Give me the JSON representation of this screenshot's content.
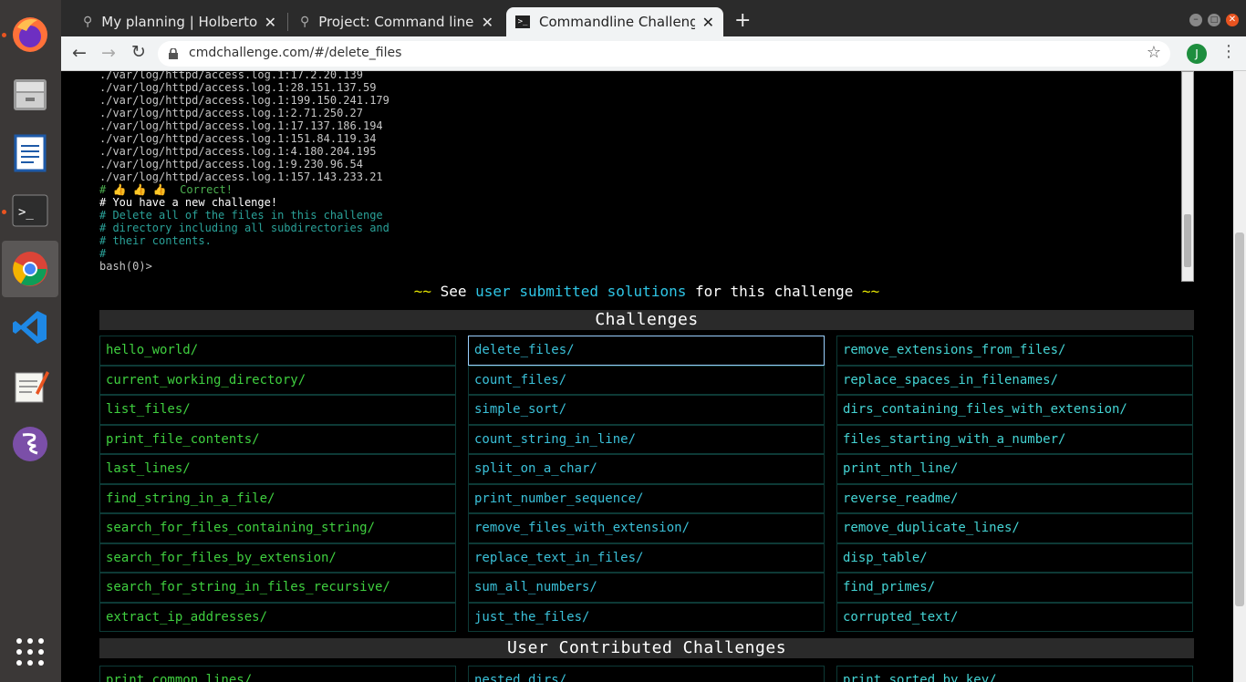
{
  "browser": {
    "tabs": [
      {
        "title": "My planning | Holberton I",
        "active": false
      },
      {
        "title": "Project: Command line fo",
        "active": false
      },
      {
        "title": "Commandline Challenge",
        "active": true
      }
    ],
    "url": "cmdchallenge.com/#/delete_files",
    "profile_initial": "J"
  },
  "terminal": {
    "output_lines": [
      "./var/log/httpd/access.log.1:17.2.20.139",
      "./var/log/httpd/access.log.1:28.151.137.59",
      "./var/log/httpd/access.log.1:199.150.241.179",
      "./var/log/httpd/access.log.1:2.71.250.27",
      "./var/log/httpd/access.log.1:17.137.186.194",
      "./var/log/httpd/access.log.1:151.84.119.34",
      "./var/log/httpd/access.log.1:4.180.204.195",
      "./var/log/httpd/access.log.1:9.230.96.54",
      "./var/log/httpd/access.log.1:157.143.233.21"
    ],
    "correct_line": "# 👍 👍 👍  Correct!",
    "new_challenge_line": "# You have a new challenge!",
    "description_lines": [
      "# Delete all of the files in this challenge",
      "# directory including all subdirectories and",
      "# their contents.",
      "#"
    ],
    "prompt": "bash(0)>"
  },
  "solutions": {
    "tilde": "~~",
    "prefix": "See",
    "link": "user submitted solutions",
    "suffix": "for this challenge"
  },
  "sections": {
    "challenges": "Challenges",
    "user_contributed": "User Contributed Challenges"
  },
  "challenges": {
    "col1": [
      "hello_world/",
      "current_working_directory/",
      "list_files/",
      "print_file_contents/",
      "last_lines/",
      "find_string_in_a_file/",
      "search_for_files_containing_string/",
      "search_for_files_by_extension/",
      "search_for_string_in_files_recursive/",
      "extract_ip_addresses/"
    ],
    "col2": [
      "delete_files/",
      "count_files/",
      "simple_sort/",
      "count_string_in_line/",
      "split_on_a_char/",
      "print_number_sequence/",
      "remove_files_with_extension/",
      "replace_text_in_files/",
      "sum_all_numbers/",
      "just_the_files/"
    ],
    "col3": [
      "remove_extensions_from_files/",
      "replace_spaces_in_filenames/",
      "dirs_containing_files_with_extension/",
      "files_starting_with_a_number/",
      "print_nth_line/",
      "reverse_readme/",
      "remove_duplicate_lines/",
      "disp_table/",
      "find_primes/",
      "corrupted_text/"
    ]
  },
  "user_challenges": [
    "print_common_lines/",
    "nested_dirs/",
    "print_sorted_by_key/"
  ]
}
